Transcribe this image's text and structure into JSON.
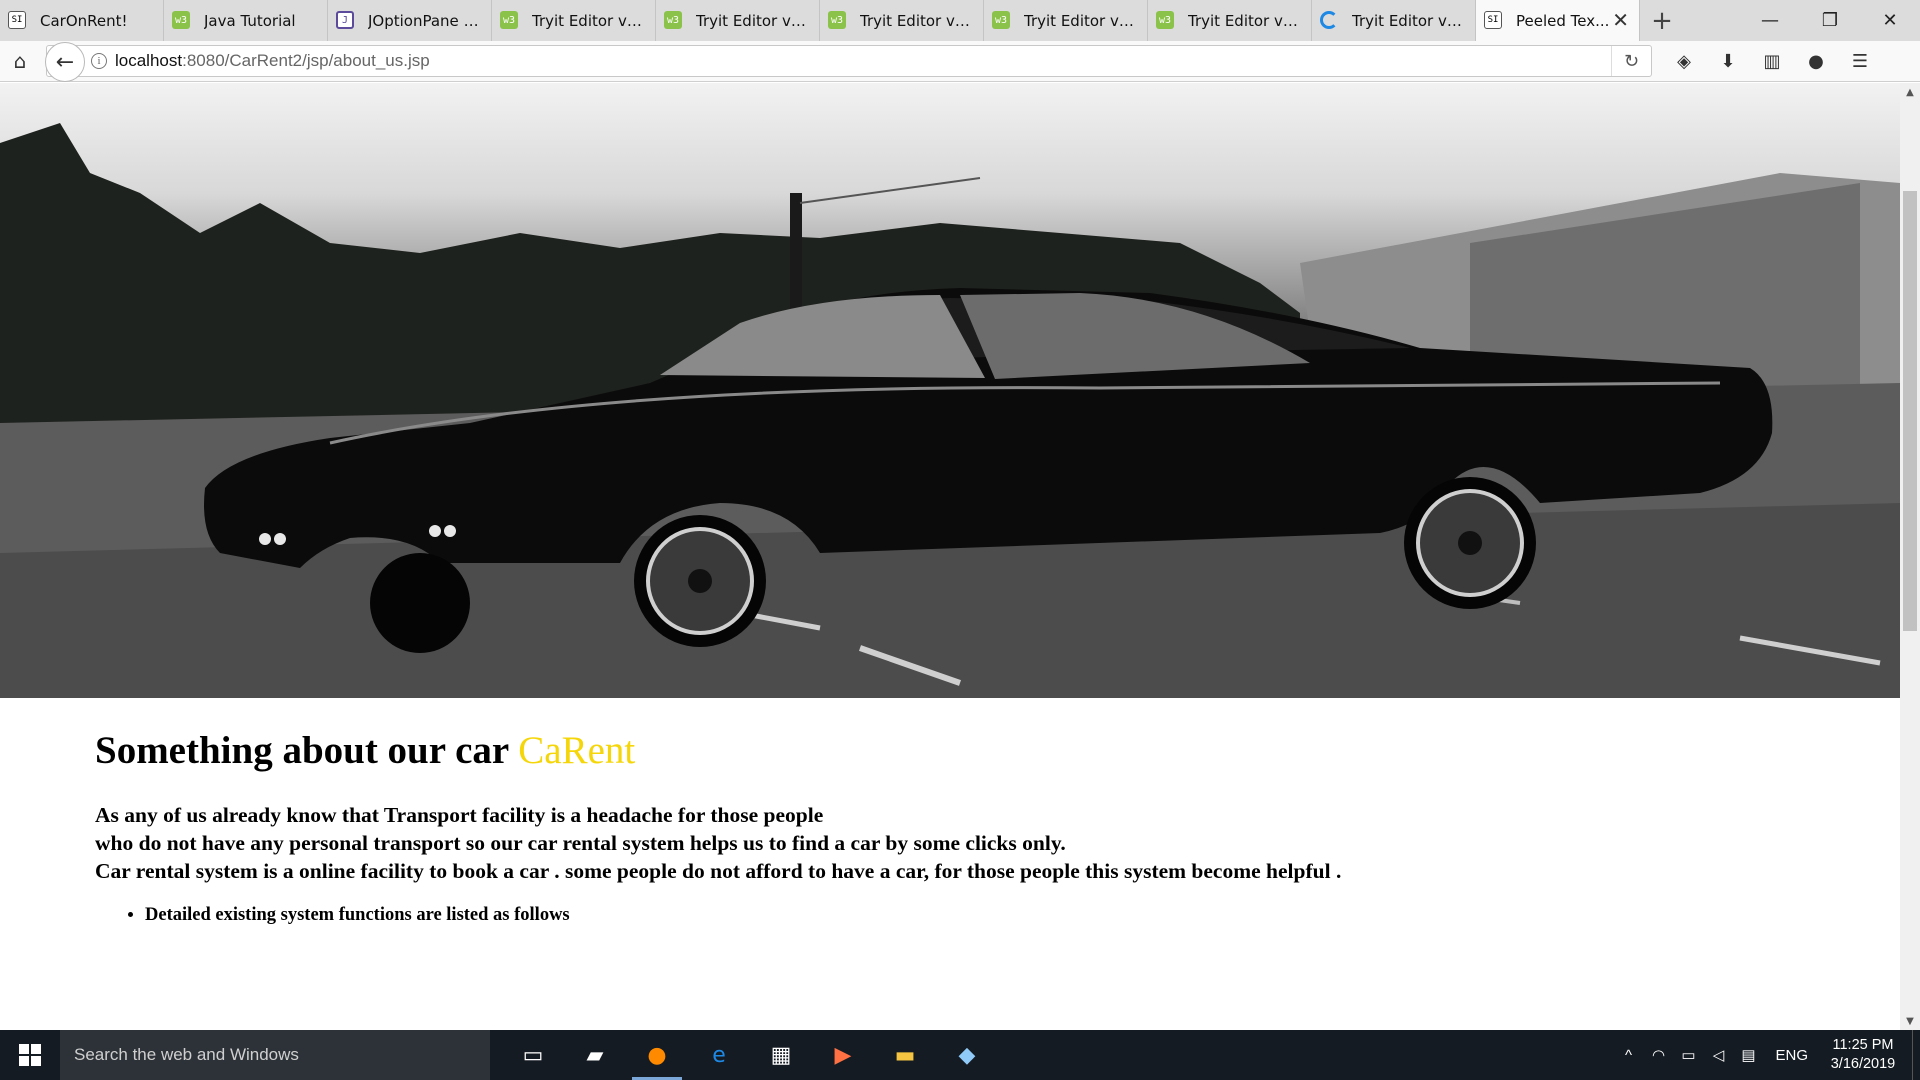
{
  "tabs": [
    {
      "title": "CarOnRent!",
      "icon": "page-favicon-icon",
      "active": false
    },
    {
      "title": "Java Tutorial",
      "icon": "w3-favicon-icon",
      "active": false
    },
    {
      "title": "JOptionPane Ut...",
      "icon": "doc-favicon-icon",
      "active": false
    },
    {
      "title": "Tryit Editor v3.6",
      "icon": "w3-favicon-icon",
      "active": false
    },
    {
      "title": "Tryit Editor v3.6",
      "icon": "w3-favicon-icon",
      "active": false
    },
    {
      "title": "Tryit Editor v3.6",
      "icon": "w3-favicon-icon",
      "active": false
    },
    {
      "title": "Tryit Editor v3.6",
      "icon": "w3-favicon-icon",
      "active": false
    },
    {
      "title": "Tryit Editor v3.6",
      "icon": "w3-favicon-icon",
      "active": false
    },
    {
      "title": "Tryit Editor v3.6",
      "icon": "loading-icon",
      "active": false
    },
    {
      "title": "Peeled Tex...",
      "icon": "page-favicon-icon",
      "active": true
    }
  ],
  "browser": {
    "url_host": "localhost",
    "url_rest": ":8080/CarRent2/jsp/about_us.jsp"
  },
  "page": {
    "heading_prefix": "Something about our car ",
    "heading_brand": "CaRent",
    "para_line1": "As any of us already know that Transport facility is a headache for those people",
    "para_line2": "who do not have any personal transport so our car rental system helps us to find a car by some clicks only.",
    "para_line3": "Car rental system is a online facility to book a car . some people do not afford to have a car, for those people this system become helpful .",
    "bullet1": "Detailed existing system functions are listed as follows",
    "brand_color": "#f5d60a"
  },
  "taskbar": {
    "search_placeholder": "Search the web and Windows",
    "language": "ENG",
    "time": "11:25 PM",
    "date": "3/16/2019"
  }
}
